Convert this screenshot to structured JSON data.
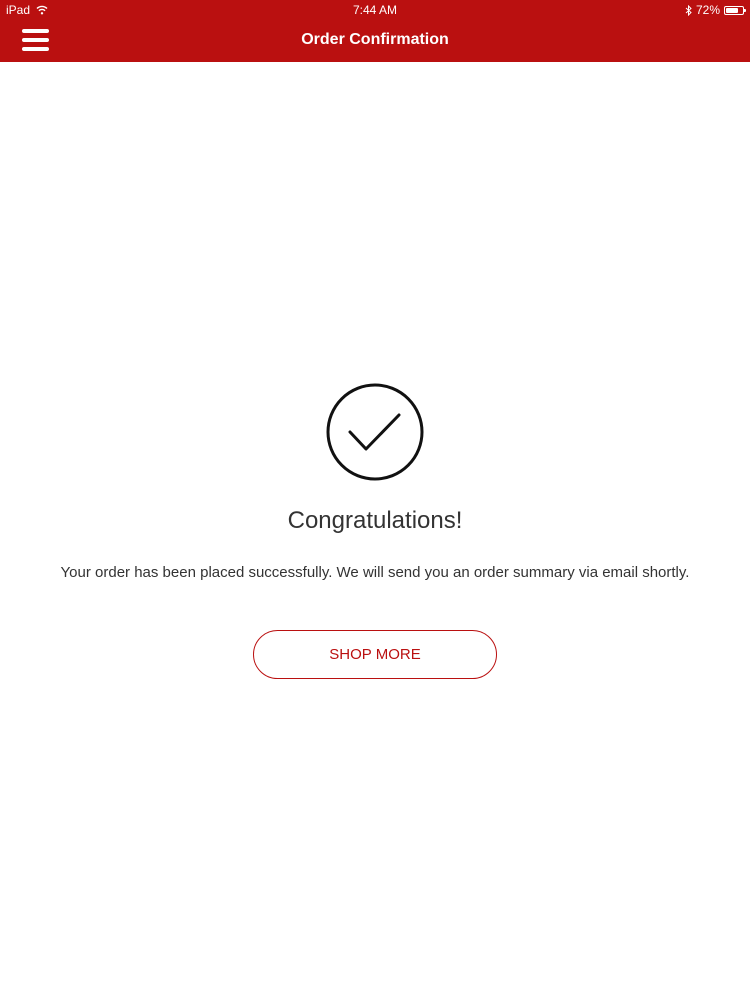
{
  "status_bar": {
    "device": "iPad",
    "time": "7:44 AM",
    "battery_percent": "72%",
    "battery_level": 0.72,
    "wifi_icon": "wifi-icon",
    "bluetooth_icon": "bluetooth-icon"
  },
  "header": {
    "title": "Order Confirmation",
    "menu_icon": "hamburger-menu-icon",
    "background_color": "#ba1010"
  },
  "confirmation": {
    "icon": "checkmark-circle-icon",
    "headline": "Congratulations!",
    "message": "Your order has been placed successfully. We will send you an order summary via email shortly.",
    "button_label": "SHOP MORE",
    "accent_color": "#ba1010"
  }
}
